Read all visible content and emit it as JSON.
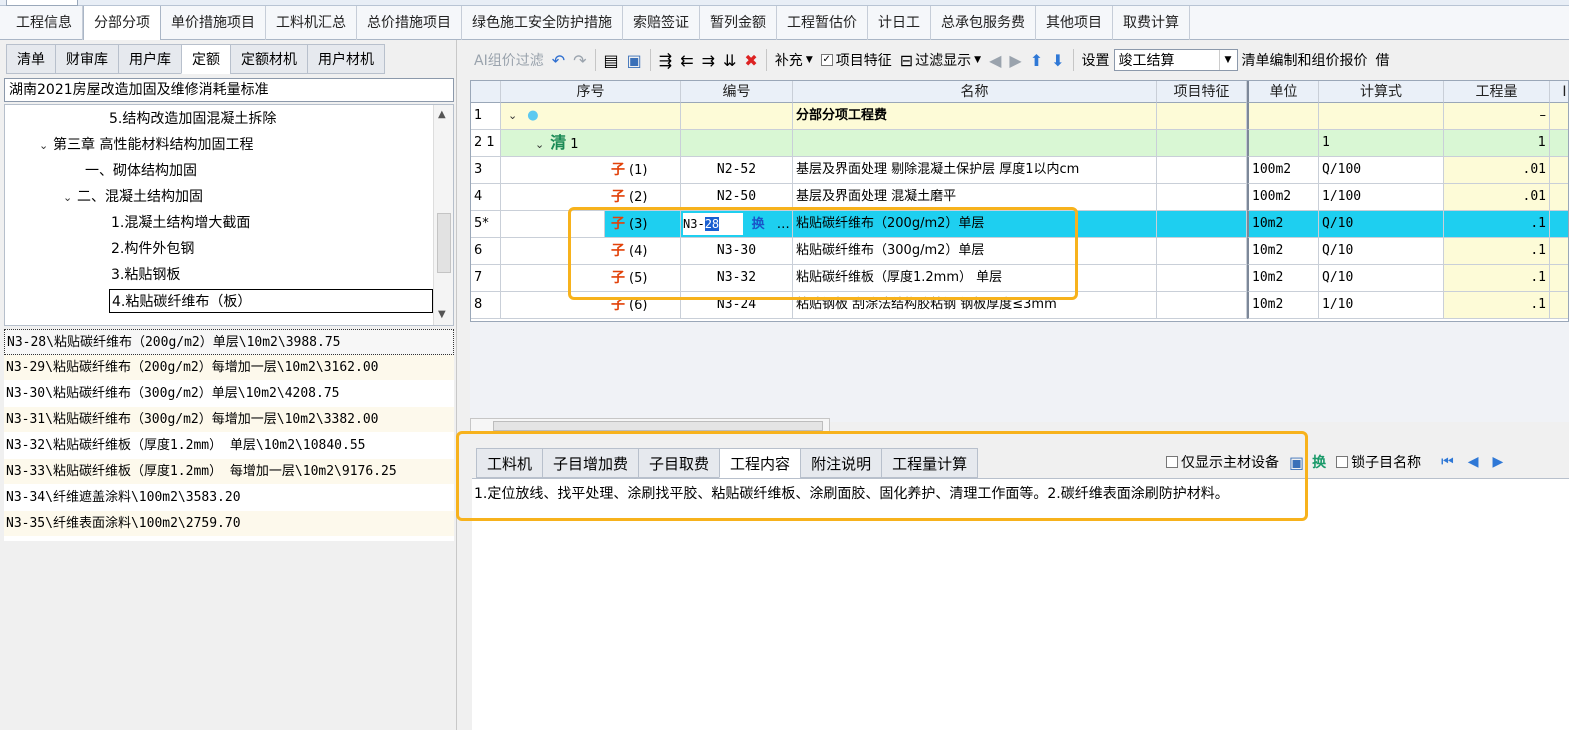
{
  "main_tabs": [
    "工程信息",
    "分部分项",
    "单价措施项目",
    "工料机汇总",
    "总价措施项目",
    "绿色施工安全防护措施",
    "索赔签证",
    "暂列金额",
    "工程暂估价",
    "计日工",
    "总承包服务费",
    "其他项目",
    "取费计算"
  ],
  "left_tabs": [
    "清单",
    "财审库",
    "用户库",
    "定额",
    "定额材机",
    "用户材机"
  ],
  "library": "湖南2021房屋改造加固及维修消耗量标准",
  "tree": {
    "n1": "5.结构改造加固混凝土拆除",
    "n2": "第三章 高性能材料结构加固工程",
    "n3": "一、砌体结构加固",
    "n4": "二、混凝土结构加固",
    "n5": "1.混凝土结构增大截面",
    "n6": "2.构件外包钢",
    "n7": "3.粘贴钢板",
    "n8": "4.粘贴碳纤维布（板）",
    "n9": "..."
  },
  "quota_list": [
    "N3-28\\粘贴碳纤维布（200g/m2）单层\\10m2\\3988.75",
    "N3-29\\粘贴碳纤维布（200g/m2）每增加一层\\10m2\\3162.00",
    "N3-30\\粘贴碳纤维布（300g/m2）单层\\10m2\\4208.75",
    "N3-31\\粘贴碳纤维布（300g/m2）每增加一层\\10m2\\3382.00",
    "N3-32\\粘贴碳纤维板（厚度1.2mm） 单层\\10m2\\10840.55",
    "N3-33\\粘贴碳纤维板（厚度1.2mm） 每增加一层\\10m2\\9176.25",
    "N3-34\\纤维遮盖涂料\\100m2\\3583.20",
    "N3-35\\纤维表面涂料\\100m2\\2759.70"
  ],
  "toolbar": {
    "ai_filter": "AI组价过滤",
    "supplement": "补充",
    "item_feature": "项目特征",
    "filter_display": "过滤显示",
    "settings": "设置",
    "settle_value": "竣工结算",
    "report": "清单编制和组价报价",
    "overflow": "借"
  },
  "grid": {
    "headers": [
      "序号",
      "编号",
      "名称",
      "项目特征",
      "单位",
      "计算式",
      "工程量",
      "I"
    ],
    "rows": [
      {
        "rn": "1",
        "seq": "",
        "code": "",
        "name": "分部分项工程费",
        "unit": "",
        "formula": "",
        "qty": "–"
      },
      {
        "rn": "2 1",
        "seq": "1",
        "code": "",
        "name": "",
        "unit": "",
        "formula": "1",
        "qty": "1"
      },
      {
        "rn": "3",
        "seq": "(1)",
        "code": "N2-52",
        "name": "基层及界面处理 剔除混凝土保护层 厚度1以内cm",
        "unit": "100m2",
        "formula": "Q/100",
        "qty": ".01"
      },
      {
        "rn": "4",
        "seq": "(2)",
        "code": "N2-50",
        "name": "基层及界面处理 混凝土磨平",
        "unit": "100m2",
        "formula": "1/100",
        "qty": ".01"
      },
      {
        "rn": "5*",
        "seq": "(3)",
        "code_prefix": "N3-",
        "code_sel": "28",
        "swap": "换",
        "more": "…",
        "name": "粘贴碳纤维布（200g/m2）单层",
        "unit": "10m2",
        "formula": "Q/10",
        "qty": ".1"
      },
      {
        "rn": "6",
        "seq": "(4)",
        "code": "N3-30",
        "name": "粘贴碳纤维布（300g/m2）单层",
        "unit": "10m2",
        "formula": "Q/10",
        "qty": ".1"
      },
      {
        "rn": "7",
        "seq": "(5)",
        "code": "N3-32",
        "name": "粘贴碳纤维板（厚度1.2mm） 单层",
        "unit": "10m2",
        "formula": "Q/10",
        "qty": ".1"
      },
      {
        "rn": "8",
        "seq": "(6)",
        "code": "N3-24",
        "name": "粘贴钢板 刮涂法结构胶粘钢 钢板厚度≤3mm",
        "unit": "10m2",
        "formula": "1/10",
        "qty": ".1"
      }
    ],
    "marker_zi": "子",
    "marker_qing": "清"
  },
  "bottom_tabs": [
    "工料机",
    "子目增加费",
    "子目取费",
    "工程内容",
    "附注说明",
    "工程量计算"
  ],
  "bottom_tools": {
    "main_only": "仅显示主材设备",
    "swap": "换",
    "lock_name": "锁子目名称"
  },
  "content_text": "1.定位放线、找平处理、涂刷找平胶、粘贴碳纤维板、涂刷面胶、固化养护、清理工作面等。2.碳纤维表面涂刷防护材料。",
  "colors": {
    "selected_row": "#1ecff0",
    "highlight": "#f7b21c",
    "yellow_cell": "#fdfbd7",
    "green_row": "#d9f7d4"
  }
}
